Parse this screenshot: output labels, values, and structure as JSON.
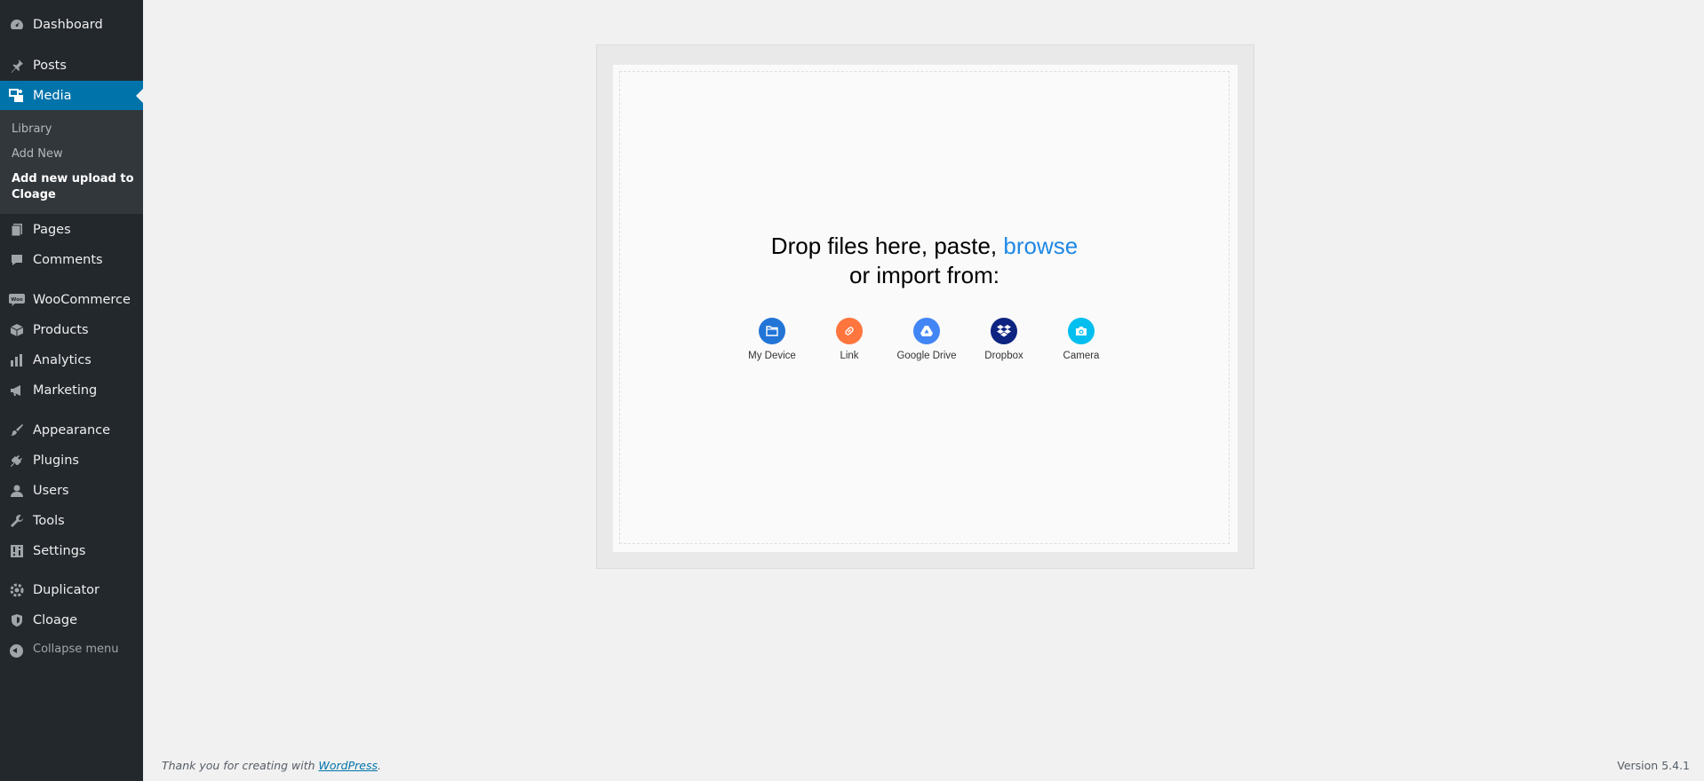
{
  "sidebar": {
    "items": [
      {
        "label": "Dashboard",
        "icon": "dashboard-icon"
      },
      {
        "label": "Posts",
        "icon": "pin-icon"
      },
      {
        "label": "Media",
        "icon": "media-icon"
      },
      {
        "label": "Pages",
        "icon": "pages-icon"
      },
      {
        "label": "Comments",
        "icon": "comment-icon"
      },
      {
        "label": "WooCommerce",
        "icon": "woo-icon"
      },
      {
        "label": "Products",
        "icon": "box-icon"
      },
      {
        "label": "Analytics",
        "icon": "bar-chart-icon"
      },
      {
        "label": "Marketing",
        "icon": "megaphone-icon"
      },
      {
        "label": "Appearance",
        "icon": "brush-icon"
      },
      {
        "label": "Plugins",
        "icon": "plug-icon"
      },
      {
        "label": "Users",
        "icon": "user-icon"
      },
      {
        "label": "Tools",
        "icon": "wrench-icon"
      },
      {
        "label": "Settings",
        "icon": "settings-icon"
      },
      {
        "label": "Duplicator",
        "icon": "gear-icon"
      },
      {
        "label": "Cloage",
        "icon": "shield-icon"
      }
    ],
    "submenu": {
      "library": "Library",
      "add_new": "Add New",
      "current": "Add new upload to Cloage"
    },
    "collapse": "Collapse menu",
    "active_color": "#0073aa"
  },
  "uploader": {
    "line1_prefix": "Drop files here, paste, ",
    "browse": "browse",
    "line2": "or import from:",
    "sources": [
      {
        "name": "My Device",
        "color": "#2275d7",
        "icon": "folder-icon"
      },
      {
        "name": "Link",
        "color": "#ff753e",
        "icon": "link-icon"
      },
      {
        "name": "Google Drive",
        "color": "#4285f4",
        "icon": "google-drive-icon"
      },
      {
        "name": "Dropbox",
        "color": "#0d2481",
        "icon": "dropbox-icon"
      },
      {
        "name": "Camera",
        "color": "#03bfef",
        "icon": "camera-icon"
      }
    ]
  },
  "footer": {
    "thanks": "Thank you for creating with ",
    "wp_link": "WordPress",
    "period": ".",
    "version": "Version 5.4.1"
  }
}
